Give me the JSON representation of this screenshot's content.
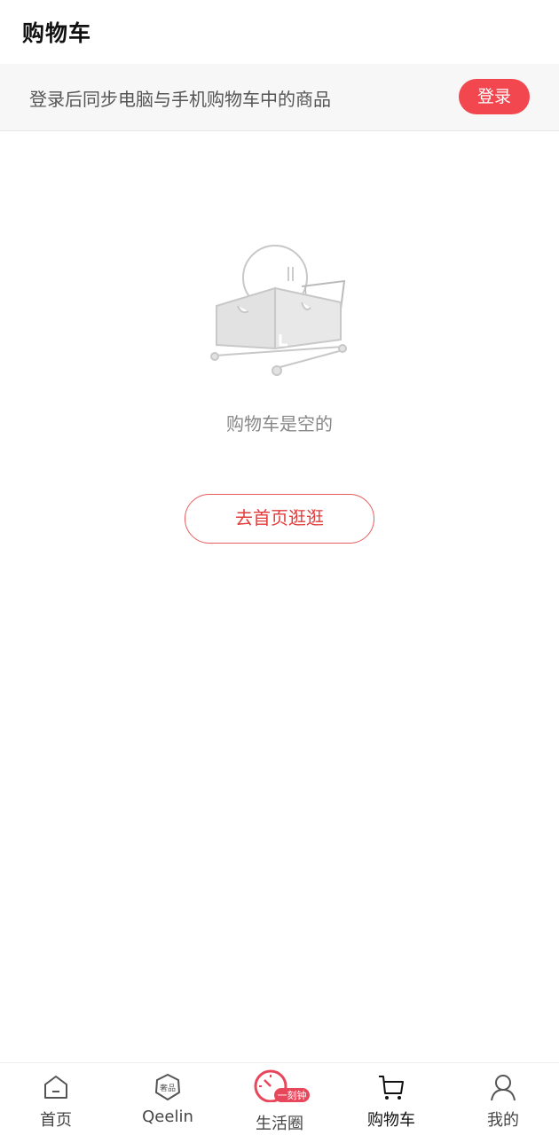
{
  "header": {
    "title": "购物车"
  },
  "login_bar": {
    "message": "登录后同步电脑与手机购物车中的商品",
    "button_label": "登录"
  },
  "empty_state": {
    "text": "购物车是空的",
    "button_label": "去首页逛逛"
  },
  "tabbar": {
    "active": "cart",
    "items": [
      {
        "id": "home",
        "label": "首页",
        "icon": "home-icon"
      },
      {
        "id": "qeelin",
        "label": "Qeelin",
        "icon": "qeelin-badge-icon",
        "icon_text": "奢品"
      },
      {
        "id": "life",
        "label": "生活圈",
        "icon": "clock-icon",
        "badge": "一刻钟"
      },
      {
        "id": "cart",
        "label": "购物车",
        "icon": "cart-icon"
      },
      {
        "id": "mine",
        "label": "我的",
        "icon": "user-icon"
      }
    ]
  },
  "colors": {
    "accent": "#f2474f",
    "outline_red": "#e85c5c",
    "bar_bg": "#f7f7f7"
  }
}
